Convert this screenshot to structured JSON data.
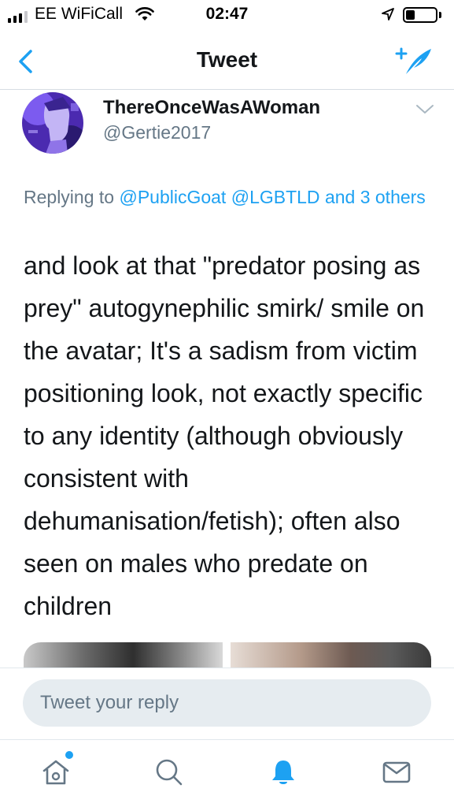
{
  "status_bar": {
    "carrier": "EE WiFiCall",
    "time": "02:47",
    "battery_level": 0.3,
    "signal_bars_active": 3,
    "signal_bars_total": 4
  },
  "nav": {
    "title": "Tweet",
    "back_icon": "chevron-left-icon",
    "compose_icon": "compose-tweet-icon"
  },
  "tweet": {
    "display_name": "ThereOnceWasAWoman",
    "handle": "@Gertie2017",
    "reply_prefix": "Replying to ",
    "reply_mention_1": "@PublicGoat",
    "reply_mention_2": "@LGBTLD",
    "reply_others": "and 3 others",
    "text": "and look at that \"predator posing as prey\" autogynephilic smirk/ smile on the avatar;  It's a sadism from victim positioning look, not exactly specific to any identity (although obviously consistent with dehumanisation/fetish); often also seen on males who predate on children"
  },
  "reply": {
    "placeholder": "Tweet your reply"
  },
  "tabs": [
    {
      "name": "home-icon"
    },
    {
      "name": "search-icon"
    },
    {
      "name": "notifications-icon"
    },
    {
      "name": "messages-icon"
    }
  ],
  "colors": {
    "accent": "#1da1f2",
    "secondary_text": "#657786",
    "primary_text": "#14171a",
    "avatar_purple": "#6b3fd6"
  }
}
